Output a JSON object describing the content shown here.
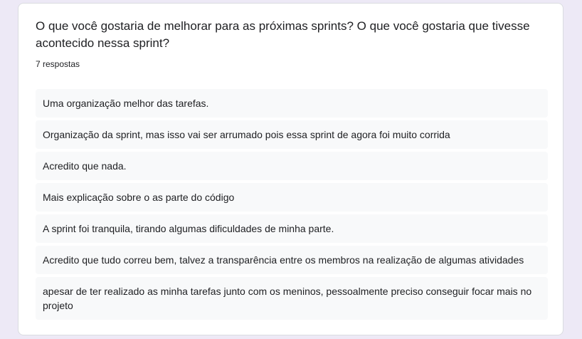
{
  "question": {
    "title": "O que você gostaria de melhorar para as próximas sprints? O que você gostaria que tivesse acontecido nessa sprint?",
    "response_count": "7 respostas"
  },
  "responses": [
    "Uma organização melhor das tarefas.",
    "Organização da sprint, mas isso vai ser arrumado pois essa sprint de agora foi muito corrida",
    "Acredito que nada.",
    "Mais explicação sobre o as parte do código",
    "A sprint foi tranquila, tirando algumas dificuldades de minha parte.",
    "Acredito que tudo correu bem, talvez a transparência entre os membros na realização de algumas atividades",
    "apesar de ter realizado as minha tarefas junto com os meninos, pessoalmente preciso conseguir focar mais no projeto"
  ],
  "colors": {
    "page_background": "#ede9f6",
    "card_background": "#ffffff",
    "response_background": "#f8f9fa",
    "text": "#202124"
  }
}
